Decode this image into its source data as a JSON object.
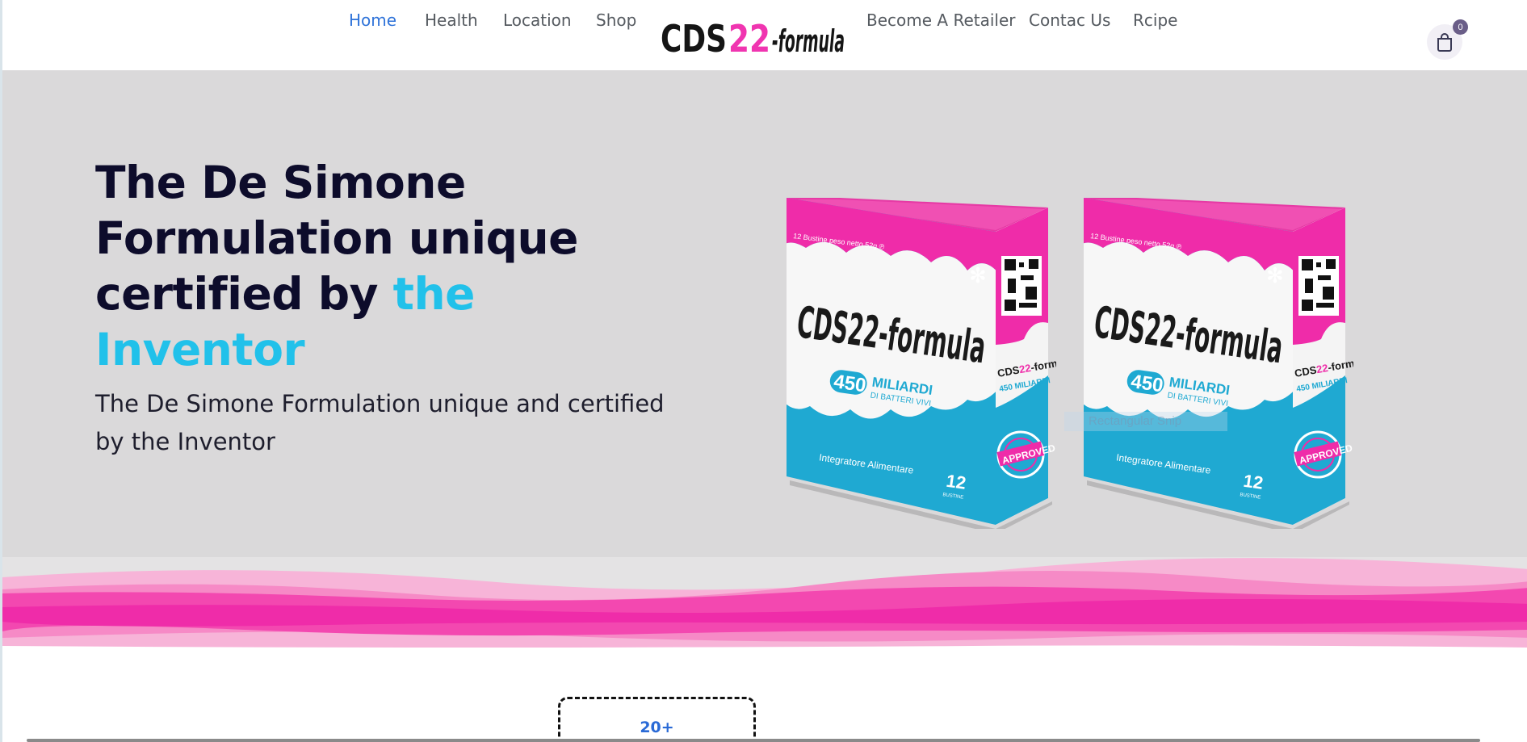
{
  "nav": {
    "left": [
      {
        "label": "Home",
        "active": true
      },
      {
        "label": "Health"
      },
      {
        "label": "Location"
      },
      {
        "label": "Shop"
      }
    ],
    "right": [
      {
        "label": "Become A Retailer"
      },
      {
        "label": "Contac Us"
      },
      {
        "label": "Rcipe"
      }
    ],
    "logo": {
      "part1": "CDS",
      "part2": "22",
      "part3": "-formula"
    },
    "cart_count": "0",
    "colors": {
      "active": "#2f73d9",
      "brand_pink": "#f035b0",
      "accent_cyan": "#21c1ea"
    }
  },
  "hero": {
    "title_plain1": "The ",
    "title_bold": "De Simone Formulation unique",
    "title_plain2": "certified by ",
    "title_accent": "the Inventor",
    "subtitle": "The De Simone Formulation unique and certified by the Inventor"
  },
  "product": {
    "brand": "CDS22-formula",
    "count_number": "450",
    "count_word": "MILIARDI",
    "count_sub": "DI BATTERI VIVI",
    "type": "Integratore Alimentare",
    "packs": "12",
    "packs_unit": "BUSTINE",
    "net": "12 Bustine peso netto 52g ℗",
    "seal": "APPROVED",
    "ghost_label": "Rectangular Snip"
  },
  "stats": {
    "first_value": "20+"
  },
  "icons": [
    "cart-icon",
    "snowflake-icon",
    "qr-code-icon",
    "approved-seal-icon"
  ]
}
